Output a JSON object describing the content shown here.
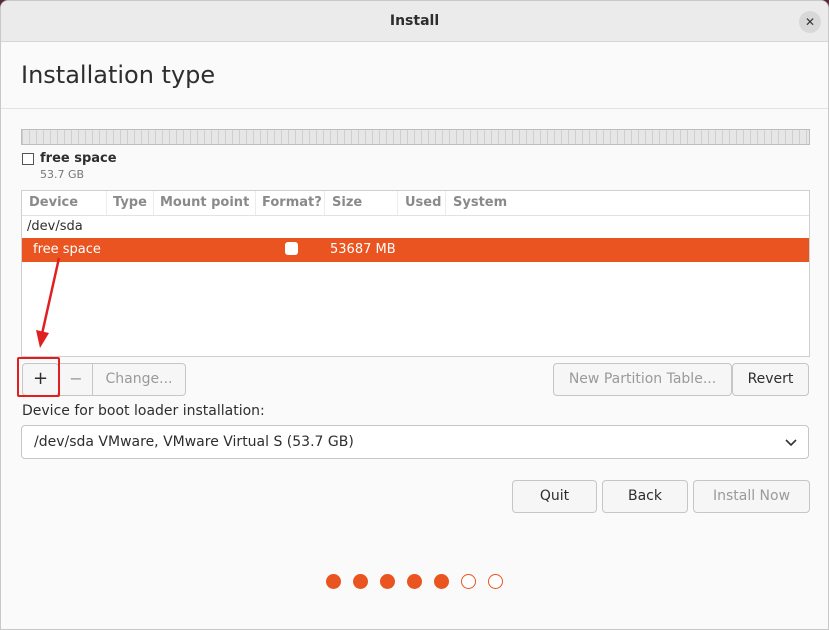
{
  "window": {
    "title": "Install",
    "close_icon": "close-icon"
  },
  "page": {
    "title": "Installation type"
  },
  "disk_legend": {
    "label": "free space",
    "size": "53.7 GB"
  },
  "table": {
    "columns": [
      "Device",
      "Type",
      "Mount point",
      "Format?",
      "Size",
      "Used",
      "System"
    ],
    "device": "/dev/sda",
    "selected_row": {
      "device": "free space",
      "type": "",
      "mount": "",
      "format_checked": false,
      "size": "53687 MB",
      "used": "",
      "system": ""
    }
  },
  "partition_buttons": {
    "add": "+",
    "remove": "−",
    "change": "Change...",
    "new_table": "New Partition Table...",
    "revert": "Revert"
  },
  "boot_loader": {
    "label": "Device for boot loader installation:",
    "value": "/dev/sda VMware, VMware Virtual S (53.7 GB)"
  },
  "nav_buttons": {
    "quit": "Quit",
    "back": "Back",
    "install": "Install Now"
  },
  "progress": {
    "total": 7,
    "completed": 5
  },
  "colors": {
    "accent": "#e95420",
    "annotation": "#e02020"
  }
}
